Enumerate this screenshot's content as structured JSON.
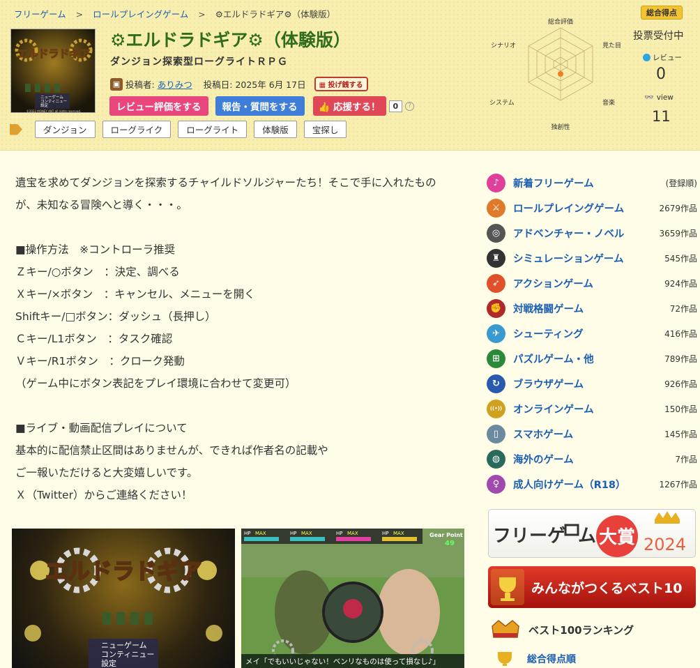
{
  "breadcrumb": {
    "crumb1": "フリーゲーム",
    "crumb2": "ロールプレイングゲーム",
    "current": "⚙エルドラドギア⚙（体験版）",
    "sep": ">"
  },
  "thumbnail": {
    "logo_text": "エルドラドギア",
    "menu1": "ニューゲーム",
    "menu2": "コンティニュー",
    "menu3": "設定",
    "copyright": "©2022 MONEY ANT all rights reserved."
  },
  "game": {
    "title": "⚙エルドラドギア⚙（体験版）",
    "subtitle": "ダンジョン探索型ローグライトＲＰＧ",
    "poster_label": "投稿者:",
    "poster_name": "ありみつ",
    "posted_label": "投稿日:",
    "posted_date": "2025年 6月 17日",
    "tip_label": "投げ銭する"
  },
  "buttons": {
    "review": "レビュー評価をする",
    "report": "報告・質問をする",
    "cheer": "応援する！",
    "cheer_count": "0",
    "help": "?"
  },
  "tags": [
    "ダンジョン",
    "ローグライク",
    "ローグライト",
    "体験版",
    "宝探し"
  ],
  "radar": {
    "top": "総合評価",
    "top_right": "見た目",
    "bottom_right": "音楽",
    "bottom": "独創性",
    "bottom_left": "システム",
    "top_left": "シナリオ"
  },
  "stats": {
    "badge": "総合得点",
    "vote_status": "投票受付中",
    "review_label": "レビュー",
    "review_count": "0",
    "view_label": "view",
    "view_count": "11"
  },
  "description": [
    "遺宝を求めてダンジョンを探索するチャイルドソルジャーたち！そこで手に入れたもの",
    "が、未知なる冒険へと導く・・・。",
    "",
    "■操作方法　※コントローラ推奨",
    "Ｚキー/○ボタン　：決定、調べる",
    "Ｘキー/×ボタン　：キャンセル、メニューを開く",
    "Shiftキー/□ボタン：ダッシュ（長押し）",
    "Ｃキー/L1ボタン　：タスク確認",
    "Ｖキー/R1ボタン　：クローク発動",
    "（ゲーム中にボタン表記をプレイ環境に合わせて変更可）",
    "",
    "■ライブ・動画配信プレイについて",
    "基本的に配信禁止区間はありませんが、できれば作者名の記載や",
    "ご一報いただけると大変嬉しいです。",
    "Ｘ（Twitter）からご連絡ください！"
  ],
  "screenshots": {
    "shot1_logo": "エルドラドギア",
    "shot1_menu1": "ニューゲーム",
    "shot1_menu2": "コンティニュー",
    "shot1_menu3": "設定",
    "shot2_hp": "HP",
    "shot2_max": "MAX",
    "shot2_gear": "Gear Point",
    "shot2_gear_val": "49",
    "shot2_dialog": "メイ「でもいいじゃない！ベンリなものは使って損なし♪」"
  },
  "sidebar": {
    "categories": [
      {
        "name": "新着フリーゲーム",
        "count": "(登録順)",
        "color": "#e0409a",
        "glyph": "♪"
      },
      {
        "name": "ロールプレイングゲーム",
        "count": "2679作品",
        "color": "#e07a2a",
        "glyph": "⚔"
      },
      {
        "name": "アドベンチャー・ノベル",
        "count": "3659作品",
        "color": "#555555",
        "glyph": "◎"
      },
      {
        "name": "シミュレーションゲーム",
        "count": "545作品",
        "color": "#333333",
        "glyph": "♜"
      },
      {
        "name": "アクションゲーム",
        "count": "924作品",
        "color": "#e0502a",
        "glyph": "➶"
      },
      {
        "name": "対戦格闘ゲーム",
        "count": "72作品",
        "color": "#b02a2a",
        "glyph": "✊"
      },
      {
        "name": "シューティング",
        "count": "416作品",
        "color": "#3a9ad0",
        "glyph": "✈"
      },
      {
        "name": "パズルゲーム・他",
        "count": "789作品",
        "color": "#2a8a3a",
        "glyph": "⊞"
      },
      {
        "name": "ブラウザゲーム",
        "count": "926作品",
        "color": "#2a5ab0",
        "glyph": "↻"
      },
      {
        "name": "オンラインゲーム",
        "count": "150作品",
        "color": "#d0a020",
        "glyph": "((•))"
      },
      {
        "name": "スマホゲーム",
        "count": "145作品",
        "color": "#6a8aa0",
        "glyph": "▯"
      },
      {
        "name": "海外のゲーム",
        "count": "7作品",
        "color": "#2a6a5a",
        "glyph": "◍"
      },
      {
        "name": "成人向けゲーム（R18）",
        "count": "1267作品",
        "color": "#a04ab0",
        "glyph": "♀"
      }
    ],
    "award_text1": "フリーゲ",
    "award_text2": "ム",
    "award_big": "大賞",
    "award_year": "2024",
    "best10": "みんながつくるベスト10",
    "best100": "ベスト100ランキング",
    "score_order": "総合得点順"
  }
}
